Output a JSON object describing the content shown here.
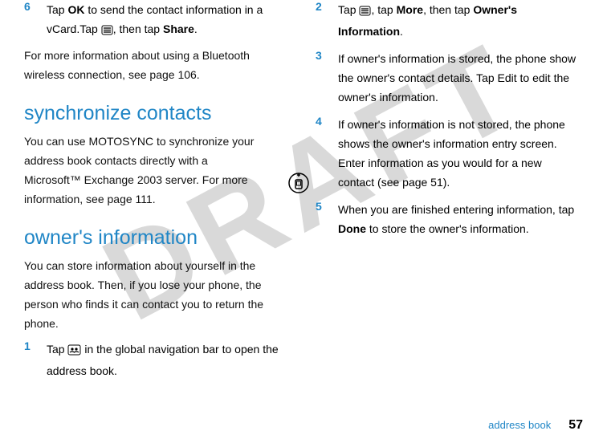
{
  "watermark": "DRAFT",
  "left": {
    "step6_num": "6",
    "step6_a": "Tap ",
    "step6_ok": "OK",
    "step6_b": " to send the contact information in a vCard.Tap ",
    "step6_c": ", then tap ",
    "step6_share": "Share",
    "step6_d": ".",
    "bt_text": "For more information about using a Bluetooth wireless connection, see page 106.",
    "sync_heading": "synchronize contacts",
    "sync_body": "You can use MOTOSYNC to synchronize your address book contacts directly with a Microsoft™ Exchange 2003 server. For more information, see page 111.",
    "owner_heading": "owner's information",
    "owner_body": "You can store information about yourself in the address book. Then, if you lose your phone, the person who finds it can contact you to return the phone.",
    "step1_num": "1",
    "step1_a": "Tap ",
    "step1_b": " in the global navigation bar to open the address book."
  },
  "right": {
    "step2_num": "2",
    "step2_a": "Tap ",
    "step2_b": ", tap ",
    "step2_more": "More",
    "step2_c": ", then tap ",
    "step2_ownerinfo": "Owner's Information",
    "step2_d": ".",
    "step3_num": "3",
    "step3_body": "If owner's information is stored, the phone show the owner's contact details. Tap Edit to edit the owner's information.",
    "step4_num": "4",
    "step4_body": "If owner's information is not stored, the phone shows the owner's information entry screen. Enter information as you would for a new contact (see page 51).",
    "step5_num": "5",
    "step5_a": "When you are finished entering information, tap ",
    "step5_done": "Done",
    "step5_b": " to store the owner's information."
  },
  "footer": {
    "label": "address book",
    "page": "57"
  }
}
